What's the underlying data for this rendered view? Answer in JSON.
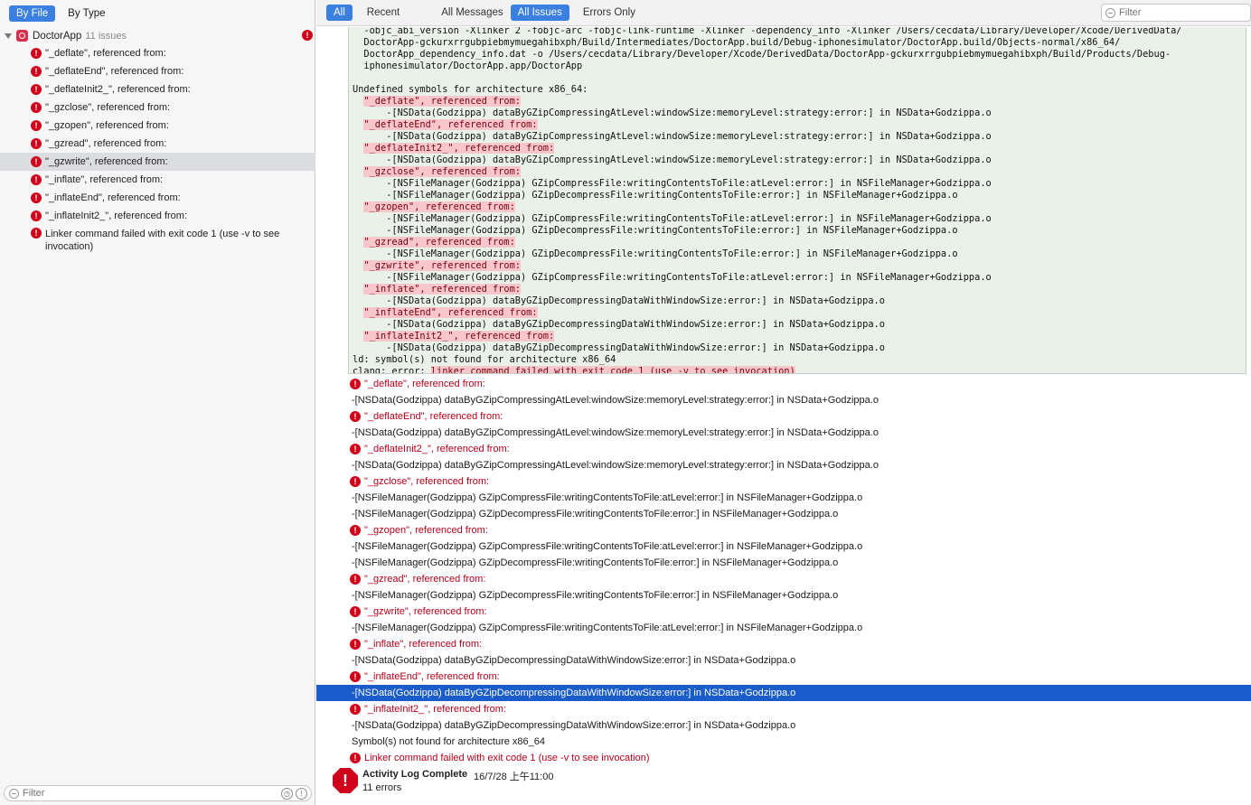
{
  "navigator": {
    "tabs": [
      {
        "label": "By File",
        "active": true
      },
      {
        "label": "By Type",
        "active": false
      }
    ],
    "project": {
      "name": "DoctorApp",
      "count": "11 issues"
    },
    "issues": [
      "\"_deflate\", referenced from:",
      "\"_deflateEnd\", referenced from:",
      "\"_deflateInit2_\", referenced from:",
      "\"_gzclose\", referenced from:",
      "\"_gzopen\", referenced from:",
      "\"_gzread\", referenced from:",
      "\"_gzwrite\", referenced from:",
      "\"_inflate\", referenced from:",
      "\"_inflateEnd\", referenced from:",
      "\"_inflateInit2_\", referenced from:",
      "Linker command failed with exit code 1 (use -v to see invocation)"
    ],
    "selected_index": 6,
    "filter_placeholder": "Filter"
  },
  "toolbar": {
    "tabs": [
      "All",
      "Recent",
      "All Messages",
      "All Issues",
      "Errors Only"
    ],
    "active_tabs": [
      "All",
      "All Issues"
    ],
    "filter_placeholder": "Filter"
  },
  "transcript": {
    "lines": [
      {
        "text": "  -objc_abi_version -Xlinker 2 -fobjc-arc -fobjc-link-runtime -Xlinker -dependency_info -Xlinker /Users/cecdata/Library/Developer/Xcode/DerivedData/"
      },
      {
        "text": "  DoctorApp-gckurxrrgubpiebmymuegahibxph/Build/Intermediates/DoctorApp.build/Debug-iphonesimulator/DoctorApp.build/Objects-normal/x86_64/"
      },
      {
        "text": "  DoctorApp_dependency_info.dat -o /Users/cecdata/Library/Developer/Xcode/DerivedData/DoctorApp-gckurxrrgubpiebmymuegahibxph/Build/Products/Debug-"
      },
      {
        "text": "  iphonesimulator/DoctorApp.app/DoctorApp"
      },
      {
        "text": ""
      },
      {
        "text": "Undefined symbols for architecture x86_64:"
      },
      {
        "pre": "  ",
        "hl": "\"_deflate\", referenced from:"
      },
      {
        "text": "      -[NSData(Godzippa) dataByGZipCompressingAtLevel:windowSize:memoryLevel:strategy:error:] in NSData+Godzippa.o"
      },
      {
        "pre": "  ",
        "hl": "\"_deflateEnd\", referenced from:"
      },
      {
        "text": "      -[NSData(Godzippa) dataByGZipCompressingAtLevel:windowSize:memoryLevel:strategy:error:] in NSData+Godzippa.o"
      },
      {
        "pre": "  ",
        "hl": "\"_deflateInit2_\", referenced from:"
      },
      {
        "text": "      -[NSData(Godzippa) dataByGZipCompressingAtLevel:windowSize:memoryLevel:strategy:error:] in NSData+Godzippa.o"
      },
      {
        "pre": "  ",
        "hl": "\"_gzclose\", referenced from:"
      },
      {
        "text": "      -[NSFileManager(Godzippa) GZipCompressFile:writingContentsToFile:atLevel:error:] in NSFileManager+Godzippa.o"
      },
      {
        "text": "      -[NSFileManager(Godzippa) GZipDecompressFile:writingContentsToFile:error:] in NSFileManager+Godzippa.o"
      },
      {
        "pre": "  ",
        "hl": "\"_gzopen\", referenced from:"
      },
      {
        "text": "      -[NSFileManager(Godzippa) GZipCompressFile:writingContentsToFile:atLevel:error:] in NSFileManager+Godzippa.o"
      },
      {
        "text": "      -[NSFileManager(Godzippa) GZipDecompressFile:writingContentsToFile:error:] in NSFileManager+Godzippa.o"
      },
      {
        "pre": "  ",
        "hl": "\"_gzread\", referenced from:"
      },
      {
        "text": "      -[NSFileManager(Godzippa) GZipDecompressFile:writingContentsToFile:error:] in NSFileManager+Godzippa.o"
      },
      {
        "pre": "  ",
        "hl": "\"_gzwrite\", referenced from:"
      },
      {
        "text": "      -[NSFileManager(Godzippa) GZipCompressFile:writingContentsToFile:atLevel:error:] in NSFileManager+Godzippa.o"
      },
      {
        "pre": "  ",
        "hl": "\"_inflate\", referenced from:"
      },
      {
        "text": "      -[NSData(Godzippa) dataByGZipDecompressingDataWithWindowSize:error:] in NSData+Godzippa.o"
      },
      {
        "pre": "  ",
        "hl": "\"_inflateEnd\", referenced from:"
      },
      {
        "text": "      -[NSData(Godzippa) dataByGZipDecompressingDataWithWindowSize:error:] in NSData+Godzippa.o"
      },
      {
        "pre": "  ",
        "hl": "\"_inflateInit2_\", referenced from:"
      },
      {
        "text": "      -[NSData(Godzippa) dataByGZipDecompressingDataWithWindowSize:error:] in NSData+Godzippa.o"
      },
      {
        "text": "ld: symbol(s) not found for architecture x86_64"
      },
      {
        "pre": "clang: error: ",
        "hl": "linker command failed with exit code 1 (use -v to see invocation)"
      }
    ]
  },
  "messages": [
    {
      "kind": "error",
      "text": "\"_deflate\", referenced from:"
    },
    {
      "kind": "sub",
      "text": "-[NSData(Godzippa) dataByGZipCompressingAtLevel:windowSize:memoryLevel:strategy:error:] in NSData+Godzippa.o"
    },
    {
      "kind": "error",
      "text": "\"_deflateEnd\", referenced from:"
    },
    {
      "kind": "sub",
      "text": "-[NSData(Godzippa) dataByGZipCompressingAtLevel:windowSize:memoryLevel:strategy:error:] in NSData+Godzippa.o"
    },
    {
      "kind": "error",
      "text": "\"_deflateInit2_\", referenced from:"
    },
    {
      "kind": "sub",
      "text": "-[NSData(Godzippa) dataByGZipCompressingAtLevel:windowSize:memoryLevel:strategy:error:] in NSData+Godzippa.o"
    },
    {
      "kind": "error",
      "text": "\"_gzclose\", referenced from:"
    },
    {
      "kind": "sub",
      "text": "-[NSFileManager(Godzippa) GZipCompressFile:writingContentsToFile:atLevel:error:] in NSFileManager+Godzippa.o"
    },
    {
      "kind": "sub",
      "text": "-[NSFileManager(Godzippa) GZipDecompressFile:writingContentsToFile:error:] in NSFileManager+Godzippa.o"
    },
    {
      "kind": "error",
      "text": "\"_gzopen\", referenced from:"
    },
    {
      "kind": "sub",
      "text": "-[NSFileManager(Godzippa) GZipCompressFile:writingContentsToFile:atLevel:error:] in NSFileManager+Godzippa.o"
    },
    {
      "kind": "sub",
      "text": "-[NSFileManager(Godzippa) GZipDecompressFile:writingContentsToFile:error:] in NSFileManager+Godzippa.o"
    },
    {
      "kind": "error",
      "text": "\"_gzread\", referenced from:"
    },
    {
      "kind": "sub",
      "text": "-[NSFileManager(Godzippa) GZipDecompressFile:writingContentsToFile:error:] in NSFileManager+Godzippa.o"
    },
    {
      "kind": "error",
      "text": "\"_gzwrite\", referenced from:"
    },
    {
      "kind": "sub",
      "text": "-[NSFileManager(Godzippa) GZipCompressFile:writingContentsToFile:atLevel:error:] in NSFileManager+Godzippa.o"
    },
    {
      "kind": "error",
      "text": "\"_inflate\", referenced from:"
    },
    {
      "kind": "sub",
      "text": "-[NSData(Godzippa) dataByGZipDecompressingDataWithWindowSize:error:] in NSData+Godzippa.o"
    },
    {
      "kind": "error",
      "text": "\"_inflateEnd\", referenced from:"
    },
    {
      "kind": "sub",
      "text": "-[NSData(Godzippa) dataByGZipDecompressingDataWithWindowSize:error:] in NSData+Godzippa.o",
      "selected": true
    },
    {
      "kind": "error",
      "text": "\"_inflateInit2_\", referenced from:"
    },
    {
      "kind": "sub",
      "text": "-[NSData(Godzippa) dataByGZipDecompressingDataWithWindowSize:error:] in NSData+Godzippa.o"
    },
    {
      "kind": "plain",
      "text": "Symbol(s) not found for architecture x86_64"
    },
    {
      "kind": "error",
      "text": "Linker command failed with exit code 1 (use -v to see invocation)"
    }
  ],
  "summary": {
    "title": "Activity Log Complete",
    "time": "16/7/28 上午11:00",
    "count": "11 errors"
  },
  "colors": {
    "accent": "#3b7fe0",
    "error": "#d0021b",
    "selection": "#1a5cc9"
  },
  "icons": {
    "error": "error-icon",
    "project": "project-icon",
    "filter": "filter-icon"
  }
}
